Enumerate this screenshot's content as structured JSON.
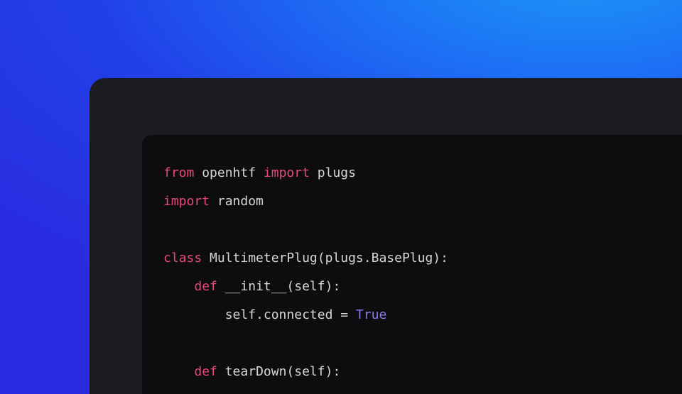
{
  "code": {
    "lines": [
      {
        "tokens": [
          {
            "cls": "kw",
            "t": "from"
          },
          {
            "cls": "dim",
            "t": " openhtf "
          },
          {
            "cls": "kw",
            "t": "import"
          },
          {
            "cls": "dim",
            "t": " plugs"
          }
        ]
      },
      {
        "tokens": [
          {
            "cls": "kw",
            "t": "import"
          },
          {
            "cls": "dim",
            "t": " random"
          }
        ]
      },
      {
        "tokens": []
      },
      {
        "tokens": [
          {
            "cls": "kw",
            "t": "class"
          },
          {
            "cls": "dim",
            "t": " "
          },
          {
            "cls": "cls",
            "t": "MultimeterPlug"
          },
          {
            "cls": "punct",
            "t": "(plugs.BasePlug):"
          }
        ]
      },
      {
        "tokens": [
          {
            "cls": "dim",
            "t": "    "
          },
          {
            "cls": "kw",
            "t": "def"
          },
          {
            "cls": "dim",
            "t": " "
          },
          {
            "cls": "fn",
            "t": "__init__"
          },
          {
            "cls": "punct",
            "t": "(self):"
          }
        ]
      },
      {
        "tokens": [
          {
            "cls": "dim",
            "t": "        self.connected = "
          },
          {
            "cls": "const",
            "t": "True"
          }
        ]
      },
      {
        "tokens": []
      },
      {
        "tokens": [
          {
            "cls": "dim",
            "t": "    "
          },
          {
            "cls": "kw",
            "t": "def"
          },
          {
            "cls": "dim",
            "t": " "
          },
          {
            "cls": "fn",
            "t": "tearDown"
          },
          {
            "cls": "punct",
            "t": "(self):"
          }
        ]
      }
    ]
  }
}
